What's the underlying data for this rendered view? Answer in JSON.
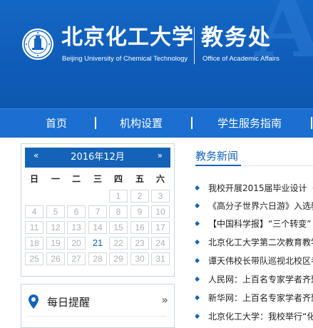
{
  "header": {
    "school_cn": "北京化工大学",
    "school_en": "Beijing University of Chemical Technology",
    "dept_cn": "教务处",
    "dept_en": "Office of Academic Affairs",
    "bg_letter": "A",
    "colors": {
      "primary": "#1463b8",
      "header_bg": "#1467c4",
      "nav_bg": "#1a6fd0"
    }
  },
  "nav": {
    "items": [
      {
        "label": "首页"
      },
      {
        "label": "机构设置"
      },
      {
        "label": "学生服务指南"
      }
    ]
  },
  "calendar": {
    "prev_label": "«",
    "next_label": "»",
    "title": "2016年12月",
    "weekdays": [
      "日",
      "一",
      "二",
      "三",
      "四",
      "五",
      "六"
    ],
    "today": "21",
    "days": [
      [
        "",
        "",
        "",
        "",
        "1",
        "2",
        "3"
      ],
      [
        "4",
        "5",
        "6",
        "7",
        "8",
        "9",
        "10"
      ],
      [
        "11",
        "12",
        "13",
        "14",
        "15",
        "16",
        "17"
      ],
      [
        "18",
        "19",
        "20",
        "21",
        "22",
        "23",
        "24"
      ],
      [
        "25",
        "26",
        "27",
        "28",
        "29",
        "30",
        "31"
      ]
    ]
  },
  "reminder": {
    "title": "每日提醒",
    "more_label": "»",
    "icon": "location-pin-icon"
  },
  "news": {
    "title": "教务新闻",
    "items": [
      {
        "text": "我校开展2015届毕业设计（"
      },
      {
        "text": "《高分子世界六日游》入选教"
      },
      {
        "text": "【中国科学报】“三个转变”"
      },
      {
        "text": "北京化工大学第二次教育教学"
      },
      {
        "text": "谭天伟校长带队巡视北校区考"
      },
      {
        "text": "人民网：上百名专家学者齐聚"
      },
      {
        "text": "新华网：上百名专家学者齐聚"
      },
      {
        "text": "北京化工大学：我校举行“化"
      }
    ]
  }
}
